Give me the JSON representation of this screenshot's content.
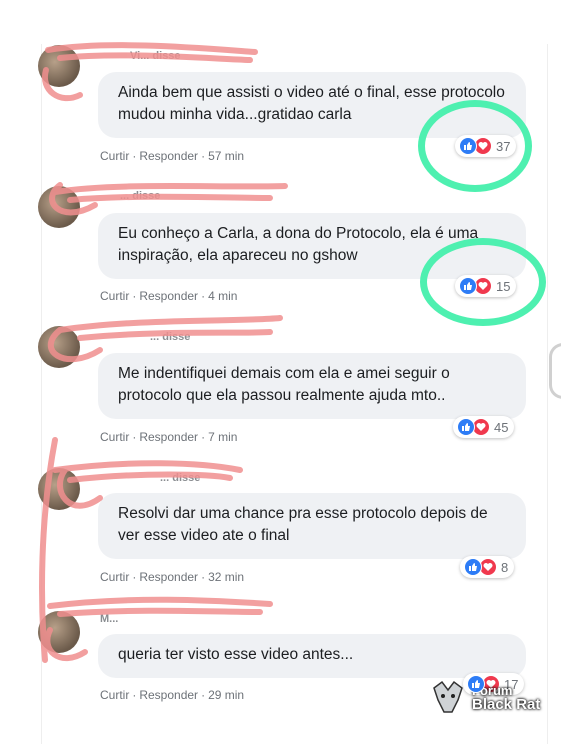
{
  "comments": [
    {
      "name_fragment": "Vi... disse",
      "text": "Ainda bem que assisti o video até o final, esse protocolo mudou minha vida...gratidao carla",
      "like": "Curtir",
      "reply": "Responder",
      "time": "57 min",
      "reactions": "37"
    },
    {
      "name_fragment": "... disse",
      "text": "Eu conheço a Carla, a dona do Protocolo, ela é uma inspiração, ela apareceu no gshow",
      "like": "Curtir",
      "reply": "Responder",
      "time": "4 min",
      "reactions": "15"
    },
    {
      "name_fragment": "... disse",
      "text": "Me indentifiquei demais com ela e amei seguir o protocolo que ela passou realmente ajuda mto..",
      "like": "Curtir",
      "reply": "Responder",
      "time": "7 min",
      "reactions": "45"
    },
    {
      "name_fragment": "... disse",
      "text": "Resolvi dar uma chance pra esse protocolo depois de ver esse video ate o final",
      "like": "Curtir",
      "reply": "Responder",
      "time": "32 min",
      "reactions": "8"
    },
    {
      "name_fragment": "M...",
      "text": "queria ter visto esse video antes...",
      "like": "Curtir",
      "reply": "Responder",
      "time": "29 min",
      "reactions": "17"
    }
  ],
  "icons": {
    "like": "thumbs-up-icon",
    "love": "heart-icon"
  },
  "colors": {
    "like": "#2d7cf6",
    "love": "#f0394e",
    "highlight": "#4ef0b0",
    "redact": "#f08f8f"
  },
  "watermark": {
    "line1": "Forum",
    "line2": "Black Rat"
  }
}
